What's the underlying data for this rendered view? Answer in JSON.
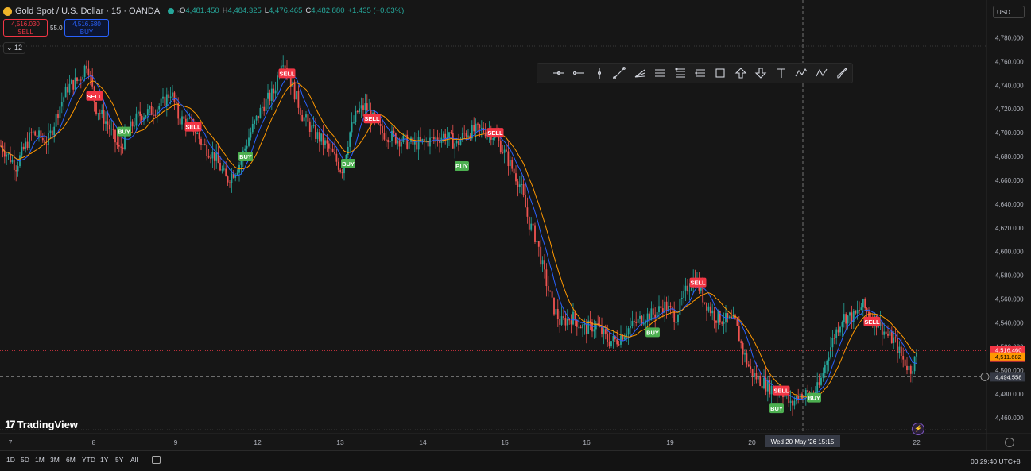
{
  "header": {
    "symbol": "Gold Spot / U.S. Dollar · 15 · OANDA",
    "ohlc": [
      {
        "k": "O",
        "v": "4,481.450"
      },
      {
        "k": "H",
        "v": "4,484.325"
      },
      {
        "k": "L",
        "v": "4,476.465"
      },
      {
        "k": "C",
        "v": "4,482.880"
      },
      {
        "k": "",
        "v": "+1.435 (+0.03%)"
      }
    ]
  },
  "trade": {
    "sell_price": "4,516.030",
    "sell_label": "SELL",
    "spread": "55.0",
    "buy_price": "4,516.580",
    "buy_label": "BUY"
  },
  "indicators_count": "12",
  "currency": "USD",
  "drawing_tools": [
    "horizontal-line-icon",
    "horizontal-ray-icon",
    "vertical-line-icon",
    "trend-line-icon",
    "pitchfork-icon",
    "parallel-channel-icon",
    "fib-retracement-icon",
    "fib-extension-icon",
    "rectangle-icon",
    "arrow-up-icon",
    "arrow-down-icon",
    "text-icon",
    "pattern-icon",
    "abcd-pattern-icon",
    "brush-icon"
  ],
  "chart_data": {
    "type": "candlestick",
    "ylim": [
      4450,
      4790
    ],
    "y_ticks": [
      4460,
      4480,
      4500,
      4520,
      4540,
      4560,
      4580,
      4600,
      4620,
      4640,
      4660,
      4680,
      4700,
      4720,
      4740,
      4760,
      4780
    ],
    "x_ticks": [
      "7",
      "8",
      "9",
      "12",
      "13",
      "14",
      "15",
      "16",
      "19",
      "20",
      "22"
    ],
    "price_path": [
      [
        0,
        4690
      ],
      [
        20,
        4672
      ],
      [
        40,
        4700
      ],
      [
        60,
        4692
      ],
      [
        75,
        4722
      ],
      [
        85,
        4738
      ],
      [
        100,
        4745
      ],
      [
        110,
        4760
      ],
      [
        120,
        4722
      ],
      [
        135,
        4708
      ],
      [
        150,
        4685
      ],
      [
        160,
        4700
      ],
      [
        175,
        4715
      ],
      [
        190,
        4718
      ],
      [
        205,
        4725
      ],
      [
        215,
        4735
      ],
      [
        225,
        4712
      ],
      [
        240,
        4708
      ],
      [
        255,
        4690
      ],
      [
        270,
        4680
      ],
      [
        285,
        4660
      ],
      [
        300,
        4672
      ],
      [
        315,
        4700
      ],
      [
        330,
        4722
      ],
      [
        345,
        4735
      ],
      [
        355,
        4765
      ],
      [
        365,
        4745
      ],
      [
        380,
        4715
      ],
      [
        395,
        4700
      ],
      [
        410,
        4690
      ],
      [
        420,
        4680
      ],
      [
        430,
        4668
      ],
      [
        440,
        4700
      ],
      [
        450,
        4718
      ],
      [
        460,
        4722
      ],
      [
        470,
        4710
      ],
      [
        480,
        4700
      ],
      [
        500,
        4695
      ],
      [
        520,
        4690
      ],
      [
        540,
        4693
      ],
      [
        560,
        4698
      ],
      [
        575,
        4690
      ],
      [
        585,
        4700
      ],
      [
        600,
        4702
      ],
      [
        615,
        4702
      ],
      [
        625,
        4695
      ],
      [
        640,
        4676
      ],
      [
        655,
        4655
      ],
      [
        665,
        4625
      ],
      [
        675,
        4610
      ],
      [
        685,
        4580
      ],
      [
        695,
        4555
      ],
      [
        705,
        4540
      ],
      [
        720,
        4545
      ],
      [
        735,
        4535
      ],
      [
        750,
        4538
      ],
      [
        765,
        4525
      ],
      [
        775,
        4525
      ],
      [
        790,
        4535
      ],
      [
        810,
        4545
      ],
      [
        825,
        4548
      ],
      [
        835,
        4555
      ],
      [
        850,
        4545
      ],
      [
        865,
        4570
      ],
      [
        875,
        4578
      ],
      [
        885,
        4560
      ],
      [
        900,
        4545
      ],
      [
        915,
        4542
      ],
      [
        925,
        4540
      ],
      [
        935,
        4515
      ],
      [
        945,
        4498
      ],
      [
        955,
        4492
      ],
      [
        970,
        4485
      ],
      [
        985,
        4482
      ],
      [
        995,
        4470
      ],
      [
        1005,
        4480
      ],
      [
        1020,
        4480
      ],
      [
        1030,
        4485
      ],
      [
        1040,
        4510
      ],
      [
        1050,
        4530
      ],
      [
        1060,
        4545
      ],
      [
        1075,
        4545
      ],
      [
        1085,
        4555
      ],
      [
        1095,
        4545
      ],
      [
        1105,
        4540
      ],
      [
        1115,
        4530
      ],
      [
        1125,
        4525
      ],
      [
        1135,
        4510
      ],
      [
        1145,
        4500
      ],
      [
        1155,
        4515
      ]
    ],
    "signals": [
      {
        "label": "SELL",
        "x": 119,
        "price": 4731
      },
      {
        "label": "BUY",
        "x": 156,
        "price": 4701
      },
      {
        "label": "SELL",
        "x": 243,
        "price": 4705
      },
      {
        "label": "BUY",
        "x": 309,
        "price": 4680
      },
      {
        "label": "SELL",
        "x": 361,
        "price": 4750
      },
      {
        "label": "BUY",
        "x": 438,
        "price": 4674
      },
      {
        "label": "SELL",
        "x": 468,
        "price": 4712
      },
      {
        "label": "BUY",
        "x": 581,
        "price": 4672
      },
      {
        "label": "SELL",
        "x": 623,
        "price": 4700
      },
      {
        "label": "BUY",
        "x": 821,
        "price": 4532
      },
      {
        "label": "SELL",
        "x": 878,
        "price": 4574
      },
      {
        "label": "SELL",
        "x": 983,
        "price": 4483
      },
      {
        "label": "BUY",
        "x": 977,
        "price": 4468
      },
      {
        "label": "BUY",
        "x": 1024,
        "price": 4477
      },
      {
        "label": "SELL",
        "x": 1097,
        "price": 4541
      }
    ],
    "price_labels": {
      "bid": {
        "price": "4,516.460",
        "countdown": "00:20",
        "value": 4516.46
      },
      "ma": {
        "price": "4,511.682",
        "value": 4511.682
      },
      "cursor": {
        "price": "4,494.558",
        "value": 4494.558
      }
    },
    "crosshair_date": "Wed 20 May '26   15:15"
  },
  "bottom": {
    "ranges": [
      "1D",
      "5D",
      "1M",
      "3M",
      "6M",
      "YTD",
      "1Y",
      "5Y",
      "All"
    ],
    "clock": "00:29:40 UTC+8"
  },
  "brand": "TradingView",
  "logo_mark": "17"
}
